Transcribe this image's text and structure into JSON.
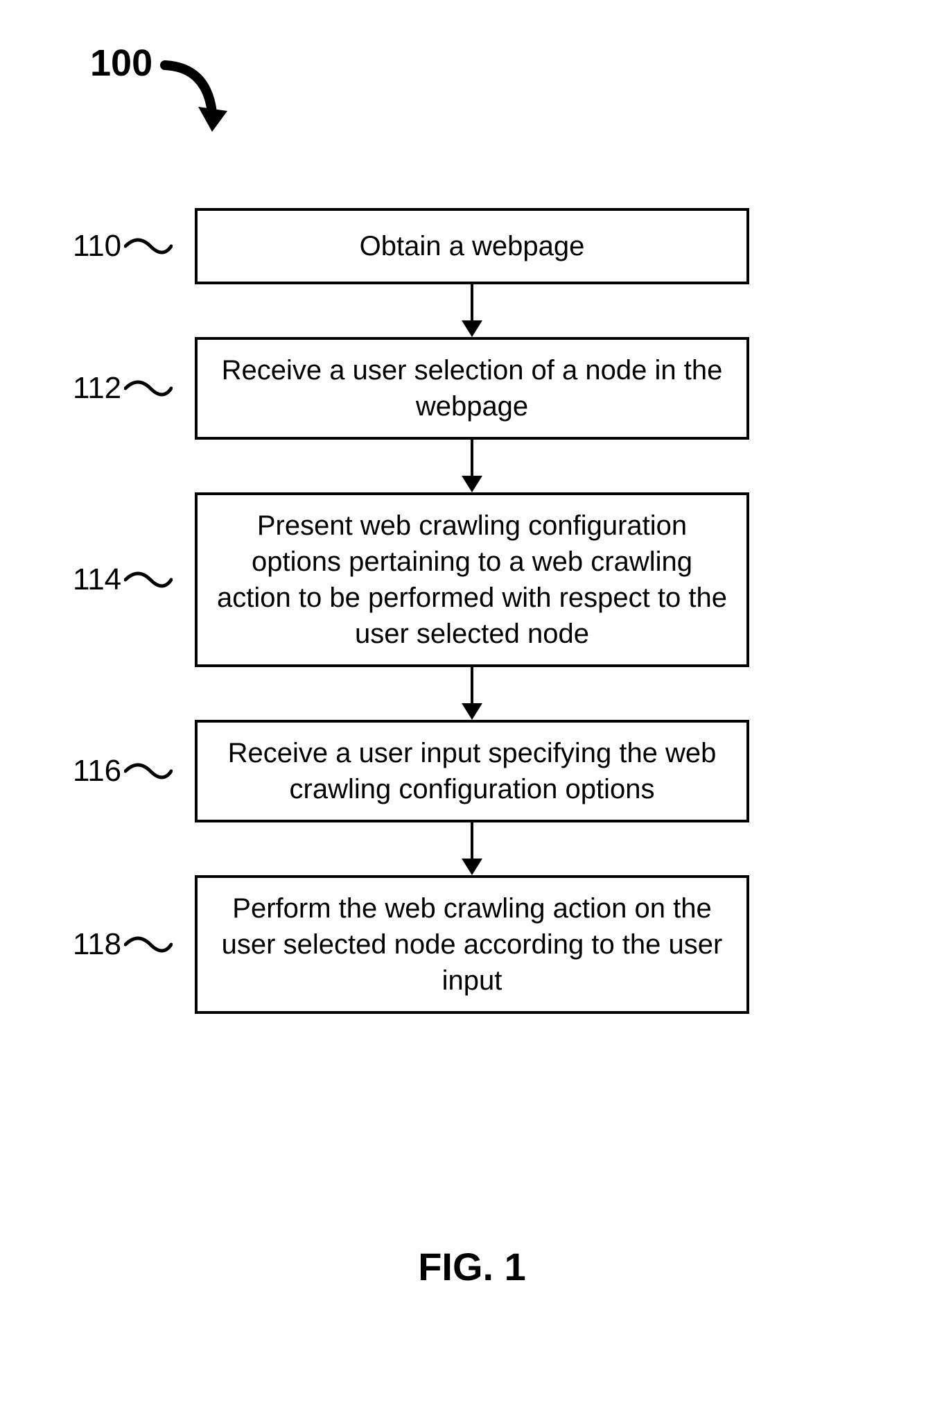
{
  "figure_ref": "100",
  "caption": "FIG. 1",
  "steps": [
    {
      "ref": "110",
      "text": "Obtain a webpage"
    },
    {
      "ref": "112",
      "text": "Receive a user selection of a node in the webpage"
    },
    {
      "ref": "114",
      "text": "Present web crawling configuration options pertaining to a web crawling action to be performed with respect to the user selected node"
    },
    {
      "ref": "116",
      "text": "Receive a user input specifying the web crawling configuration options"
    },
    {
      "ref": "118",
      "text": "Perform the web crawling action on the user selected node according to the user input"
    }
  ]
}
